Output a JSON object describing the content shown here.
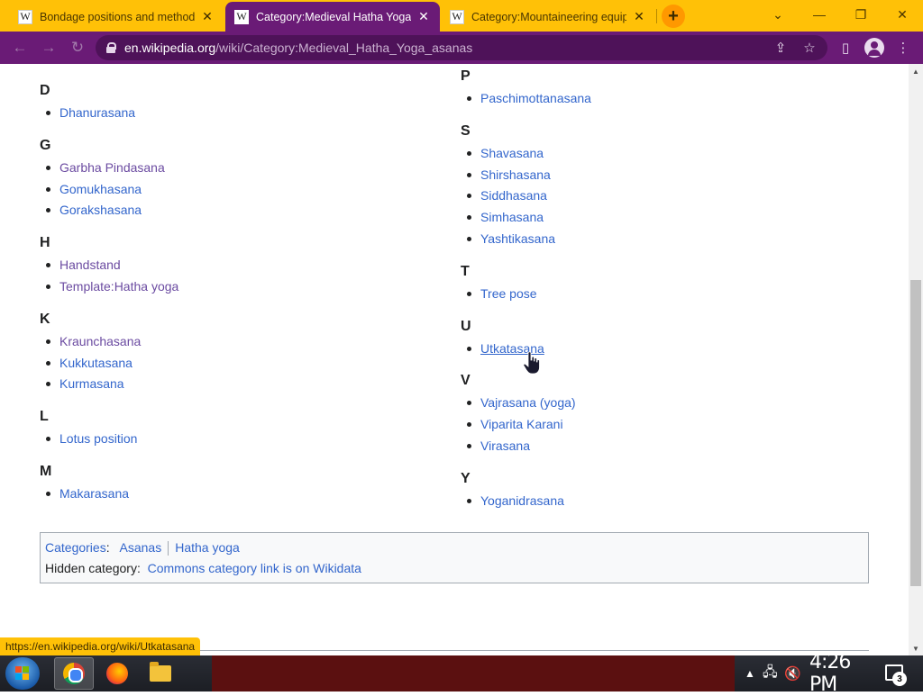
{
  "browser": {
    "tabs": [
      {
        "title": "Bondage positions and methods",
        "active": false
      },
      {
        "title": "Category:Medieval Hatha Yoga",
        "active": true
      },
      {
        "title": "Category:Mountaineering equip",
        "active": false
      }
    ],
    "tab_logo": "W",
    "close_glyph": "✕",
    "new_tab_glyph": "+",
    "window_controls": {
      "tabsearch": "⌄",
      "minimize": "—",
      "restore": "❐",
      "close": "✕"
    },
    "nav": {
      "back": "←",
      "forward": "→",
      "reload": "↻"
    },
    "url_host": "en.wikipedia.org",
    "url_path": "/wiki/Category:Medieval_Hatha_Yoga_asanas",
    "icons": {
      "share": "⇪",
      "bookmark": "☆",
      "sidepanel": "▯",
      "menu": "⋮"
    },
    "theme_color": "#6a1b76",
    "tabstrip_color": "#ffc107"
  },
  "page": {
    "left_groups": [
      {
        "letter": "D",
        "items": [
          {
            "label": "Dhanurasana",
            "visited": false
          }
        ]
      },
      {
        "letter": "G",
        "items": [
          {
            "label": "Garbha Pindasana",
            "visited": true
          },
          {
            "label": "Gomukhasana",
            "visited": false
          },
          {
            "label": "Gorakshasana",
            "visited": false
          }
        ]
      },
      {
        "letter": "H",
        "items": [
          {
            "label": "Handstand",
            "visited": true
          },
          {
            "label": "Template:Hatha yoga",
            "visited": true
          }
        ]
      },
      {
        "letter": "K",
        "items": [
          {
            "label": "Kraunchasana",
            "visited": true
          },
          {
            "label": "Kukkutasana",
            "visited": false
          },
          {
            "label": "Kurmasana",
            "visited": false
          }
        ]
      },
      {
        "letter": "L",
        "items": [
          {
            "label": "Lotus position",
            "visited": false
          }
        ]
      },
      {
        "letter": "M",
        "items": [
          {
            "label": "Makarasana",
            "visited": false
          }
        ]
      }
    ],
    "right_groups": [
      {
        "letter": "P",
        "items": [
          {
            "label": "Paschimottanasana",
            "visited": false
          }
        ]
      },
      {
        "letter": "S",
        "items": [
          {
            "label": "Shavasana",
            "visited": false
          },
          {
            "label": "Shirshasana",
            "visited": false
          },
          {
            "label": "Siddhasana",
            "visited": false
          },
          {
            "label": "Simhasana",
            "visited": false
          },
          {
            "label": "Yashtikasana",
            "visited": false
          }
        ]
      },
      {
        "letter": "T",
        "items": [
          {
            "label": "Tree pose",
            "visited": false
          }
        ]
      },
      {
        "letter": "U",
        "items": [
          {
            "label": "Utkatasana",
            "visited": false,
            "hover": true
          }
        ]
      },
      {
        "letter": "V",
        "items": [
          {
            "label": "Vajrasana (yoga)",
            "visited": false
          },
          {
            "label": "Viparita Karani",
            "visited": false
          },
          {
            "label": "Virasana",
            "visited": false
          }
        ]
      },
      {
        "letter": "Y",
        "items": [
          {
            "label": "Yoganidrasana",
            "visited": false
          }
        ]
      }
    ],
    "catlinks": {
      "categories_label": "Categories",
      "categories": [
        "Asanas",
        "Hatha yoga"
      ],
      "hidden_label": "Hidden category:",
      "hidden": [
        "Commons category link is on Wikidata"
      ]
    },
    "status_url": "https://en.wikipedia.org/wiki/Utkatasana",
    "link_color": "#3366cc",
    "visited_color": "#6b4ba1"
  },
  "taskbar": {
    "apps": [
      "chrome-icon",
      "firefox-icon",
      "file-explorer-icon"
    ],
    "clock": "4:26 PM",
    "notification_count": "3",
    "tray_expand": "▲"
  }
}
